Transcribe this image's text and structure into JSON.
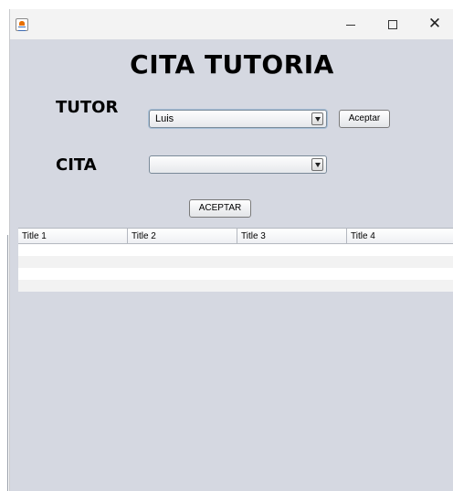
{
  "window": {
    "title": "",
    "controls": {
      "minimize_icon": "minimize-icon",
      "maximize_icon": "maximize-icon",
      "close_icon": "close-icon",
      "close_glyph": "✕"
    }
  },
  "form": {
    "heading": "CITA TUTORIA",
    "tutor_label": "TUTOR",
    "tutor_selected": "Luis",
    "tutor_button": "Aceptar",
    "cita_label": "CITA",
    "cita_selected": "",
    "submit_button": "ACEPTAR"
  },
  "table": {
    "columns": [
      "Title 1",
      "Title 2",
      "Title 3",
      "Title 4"
    ],
    "rows": [
      [
        "",
        "",
        "",
        ""
      ],
      [
        "",
        "",
        "",
        ""
      ],
      [
        "",
        "",
        "",
        ""
      ],
      [
        "",
        "",
        "",
        ""
      ]
    ]
  },
  "colors": {
    "background": "#d5d8e1",
    "titlebar": "#f3f3f3",
    "row_alt": "#f2f2f2"
  }
}
